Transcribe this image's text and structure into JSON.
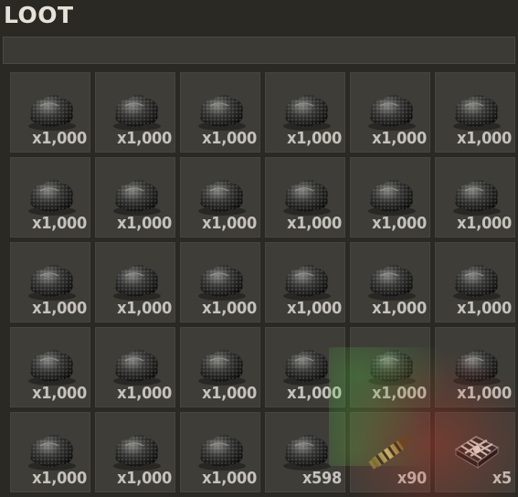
{
  "panel": {
    "title": "LOOT"
  },
  "slots": [
    {
      "item": "coal-icon",
      "qty": "x1,000"
    },
    {
      "item": "coal-icon",
      "qty": "x1,000"
    },
    {
      "item": "coal-icon",
      "qty": "x1,000"
    },
    {
      "item": "coal-icon",
      "qty": "x1,000"
    },
    {
      "item": "coal-icon",
      "qty": "x1,000"
    },
    {
      "item": "coal-icon",
      "qty": "x1,000"
    },
    {
      "item": "coal-icon",
      "qty": "x1,000"
    },
    {
      "item": "coal-icon",
      "qty": "x1,000"
    },
    {
      "item": "coal-icon",
      "qty": "x1,000"
    },
    {
      "item": "coal-icon",
      "qty": "x1,000"
    },
    {
      "item": "coal-icon",
      "qty": "x1,000"
    },
    {
      "item": "coal-icon",
      "qty": "x1,000"
    },
    {
      "item": "coal-icon",
      "qty": "x1,000"
    },
    {
      "item": "coal-icon",
      "qty": "x1,000"
    },
    {
      "item": "coal-icon",
      "qty": "x1,000"
    },
    {
      "item": "coal-icon",
      "qty": "x1,000"
    },
    {
      "item": "coal-icon",
      "qty": "x1,000"
    },
    {
      "item": "coal-icon",
      "qty": "x1,000"
    },
    {
      "item": "coal-icon",
      "qty": "x1,000"
    },
    {
      "item": "coal-icon",
      "qty": "x1,000"
    },
    {
      "item": "coal-icon",
      "qty": "x1,000"
    },
    {
      "item": "coal-icon",
      "qty": "x1,000"
    },
    {
      "item": "coal-icon",
      "qty": "x1,000"
    },
    {
      "item": "coal-icon",
      "qty": "x1,000"
    },
    {
      "item": "coal-icon",
      "qty": "x1,000"
    },
    {
      "item": "coal-icon",
      "qty": "x1,000"
    },
    {
      "item": "coal-icon",
      "qty": "x1,000"
    },
    {
      "item": "coal-icon",
      "qty": "x598"
    },
    {
      "item": "rifle-ammo-icon",
      "qty": "x90"
    },
    {
      "item": "explosive-pack-icon",
      "qty": "x5"
    }
  ]
}
